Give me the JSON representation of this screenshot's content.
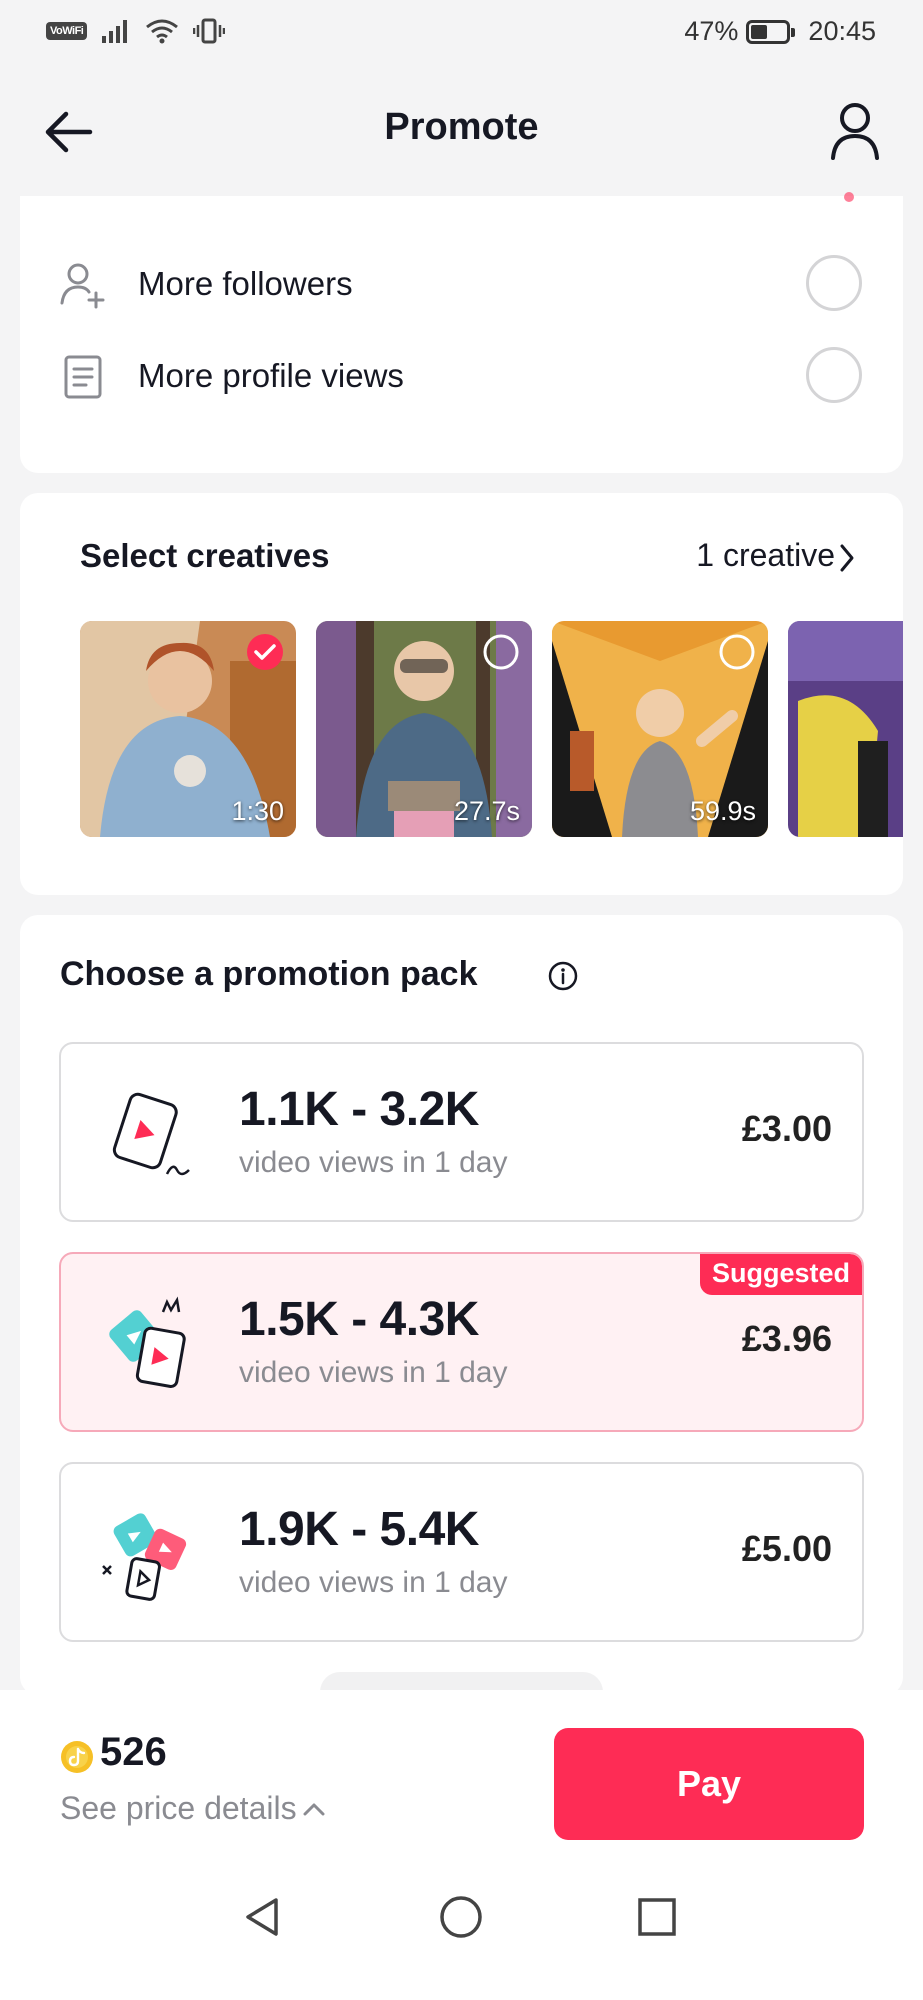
{
  "status_bar": {
    "network_label": "VoWiFi",
    "battery_percent": "47%",
    "battery_level": 0.47,
    "time": "20:45"
  },
  "header": {
    "title": "Promote",
    "back_icon": "arrow-left-icon",
    "profile_icon": "person-icon"
  },
  "goals": {
    "items": [
      {
        "label": "More followers",
        "icon": "add-person-icon",
        "selected": false
      },
      {
        "label": "More profile views",
        "icon": "document-icon",
        "selected": false
      }
    ]
  },
  "creatives": {
    "title": "Select creatives",
    "count_label": "1 creative",
    "thumbnails": [
      {
        "duration": "1:30",
        "selected": true
      },
      {
        "duration": "27.7s",
        "selected": false
      },
      {
        "duration": "59.9s",
        "selected": false
      },
      {
        "duration": "",
        "selected": false
      }
    ]
  },
  "packs": {
    "title": "Choose a promotion pack",
    "items": [
      {
        "range": "1.1K - 3.2K",
        "subtitle": "video views in 1 day",
        "price": "£3.00",
        "badge": ""
      },
      {
        "range": "1.5K - 4.3K",
        "subtitle": "video views in 1 day",
        "price": "£3.96",
        "badge": "Suggested"
      },
      {
        "range": "1.9K - 5.4K",
        "subtitle": "video views in 1 day",
        "price": "£5.00",
        "badge": ""
      }
    ]
  },
  "footer": {
    "coin_balance": "526",
    "price_details": "See price details",
    "pay_label": "Pay"
  },
  "colors": {
    "accent": "#fe2c55",
    "background": "#f4f4f5",
    "text": "#161823",
    "muted": "#8a8b91"
  }
}
